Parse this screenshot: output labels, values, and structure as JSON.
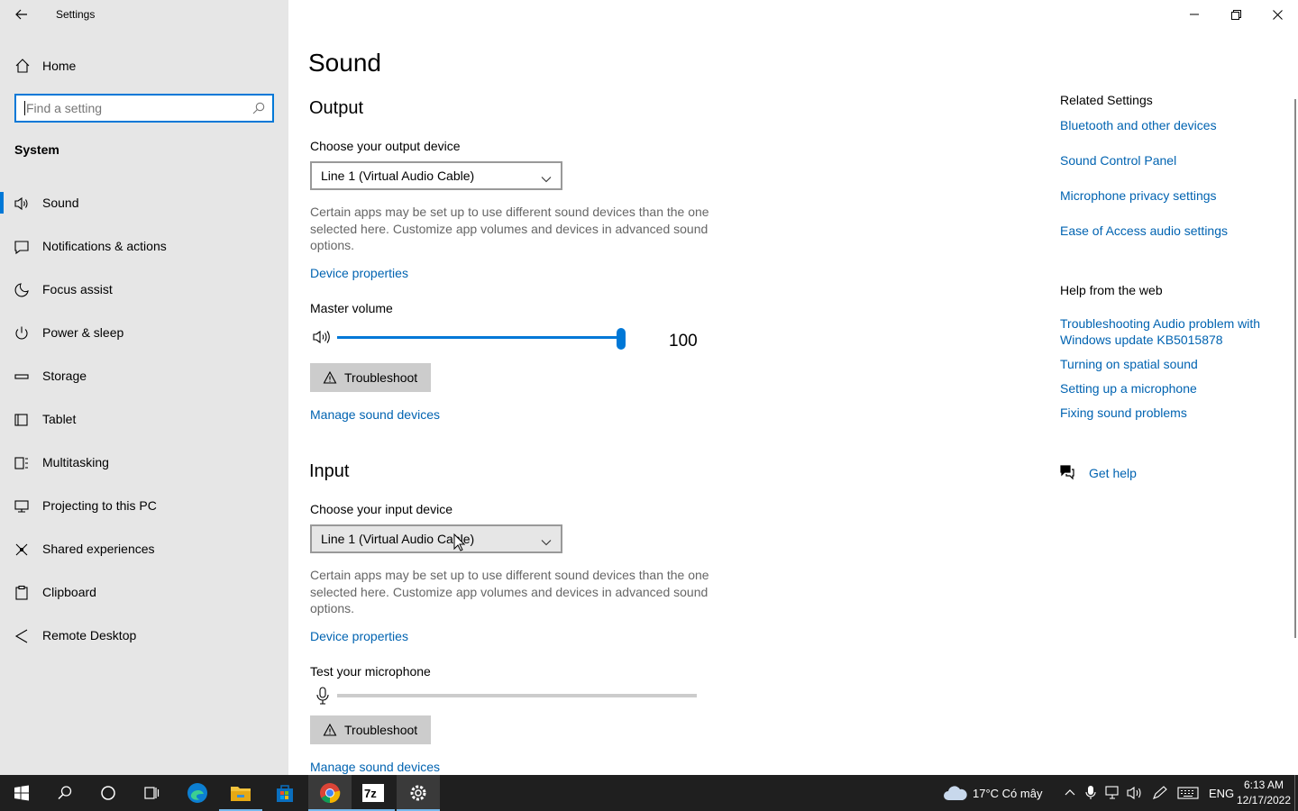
{
  "app": {
    "title": "Settings"
  },
  "sidebar": {
    "home_label": "Home",
    "search_placeholder": "Find a setting",
    "section_title": "System",
    "items": [
      {
        "label": "Sound",
        "icon": "speaker-icon",
        "active": true
      },
      {
        "label": "Notifications & actions",
        "icon": "notifications-icon"
      },
      {
        "label": "Focus assist",
        "icon": "moon-icon"
      },
      {
        "label": "Power & sleep",
        "icon": "power-icon"
      },
      {
        "label": "Storage",
        "icon": "storage-icon"
      },
      {
        "label": "Tablet",
        "icon": "tablet-icon"
      },
      {
        "label": "Multitasking",
        "icon": "multitasking-icon"
      },
      {
        "label": "Projecting to this PC",
        "icon": "projecting-icon"
      },
      {
        "label": "Shared experiences",
        "icon": "shared-experiences-icon"
      },
      {
        "label": "Clipboard",
        "icon": "clipboard-icon"
      },
      {
        "label": "Remote Desktop",
        "icon": "remote-desktop-icon"
      }
    ]
  },
  "main": {
    "title": "Sound",
    "output": {
      "heading": "Output",
      "device_label": "Choose your output device",
      "device_value": "Line 1 (Virtual Audio Cable)",
      "description": "Certain apps may be set up to use different sound devices than the one selected here. Customize app volumes and devices in advanced sound options.",
      "device_properties": "Device properties",
      "master_volume_label": "Master volume",
      "volume_value": "100",
      "troubleshoot": "Troubleshoot",
      "manage_devices": "Manage sound devices"
    },
    "input": {
      "heading": "Input",
      "device_label": "Choose your input device",
      "device_value": "Line 1 (Virtual Audio Cable)",
      "description": "Certain apps may be set up to use different sound devices than the one selected here. Customize app volumes and devices in advanced sound options.",
      "device_properties": "Device properties",
      "test_mic_label": "Test your microphone",
      "troubleshoot": "Troubleshoot",
      "manage_devices": "Manage sound devices"
    }
  },
  "related": {
    "title": "Related Settings",
    "links": [
      "Bluetooth and other devices",
      "Sound Control Panel",
      "Microphone privacy settings",
      "Ease of Access audio settings"
    ],
    "help_title": "Help from the web",
    "help_links": [
      "Troubleshooting Audio problem with Windows update KB5015878",
      "Turning on spatial sound",
      "Setting up a microphone",
      "Fixing sound problems"
    ],
    "get_help": "Get help"
  },
  "taskbar": {
    "weather": "17°C  Có mây",
    "language": "ENG",
    "time": "6:13 AM",
    "date": "12/17/2022"
  },
  "colors": {
    "accent": "#0078d7",
    "link": "#0063b1",
    "sidebar_bg": "#e6e6e6",
    "taskbar_bg": "#1f1f1f"
  }
}
